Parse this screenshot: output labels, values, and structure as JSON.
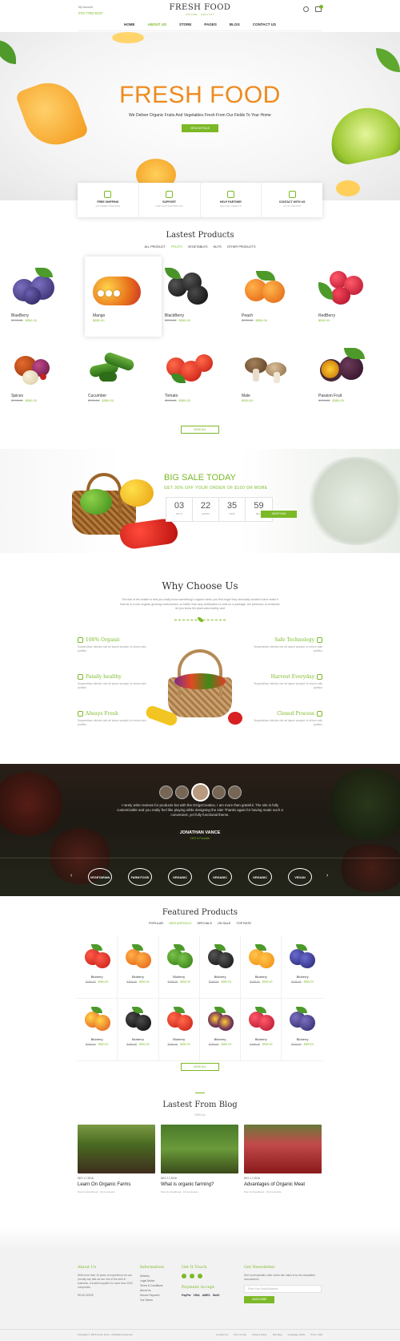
{
  "header": {
    "account": "My Account",
    "phone": "070-7782-9137",
    "logo": "FRESH FOOD",
    "tagline": "NATURE · HEALTHY",
    "nav": [
      "HOME",
      "ABOUT US",
      "STORE",
      "PAGES",
      "BLOG",
      "CONTACT US"
    ],
    "active_nav": "ABOUT US"
  },
  "hero": {
    "title": "FRESH FOOD",
    "subtitle": "We Deliver Organic Fruits And Vegetables Fresh From Our Fields To Your Home",
    "button": "VIEW DETAILS"
  },
  "features": [
    {
      "title": "FREE SHIPPING",
      "sub": "ON ORDER OVER $100",
      "icon": "plane-icon"
    },
    {
      "title": "SUPPORT",
      "sub": "LIVE CHAT SUPPORT 24/7",
      "icon": "support-icon"
    },
    {
      "title": "HELP PARTNER",
      "sub": "HELP ALL ASPECTS",
      "icon": "handshake-icon"
    },
    {
      "title": "CONTACT WITH US",
      "sub": "+07 (0) 7782 9137",
      "icon": "phone-icon"
    }
  ],
  "latest": {
    "title": "Lastest Products",
    "tabs": [
      "ALL PRODUCT",
      "FRUITS",
      "VEGETABLES",
      "NUTS",
      "OTHER PRODUCTS"
    ],
    "active_tab": "FRUITS",
    "products": [
      {
        "name": "BlueBerry",
        "old": "$799.00",
        "price": "$550.00"
      },
      {
        "name": "Mango",
        "old": "",
        "price": "$550.00"
      },
      {
        "name": "BlackBerry",
        "old": "$799.00",
        "price": "$550.00"
      },
      {
        "name": "Peach",
        "old": "$799.00",
        "price": "$550.00"
      },
      {
        "name": "RedBerry",
        "old": "",
        "price": "$550.00"
      },
      {
        "name": "Spices",
        "old": "$799.00",
        "price": "$550.00"
      },
      {
        "name": "Cucumber",
        "old": "$799.00",
        "price": "$550.00"
      },
      {
        "name": "Tomato",
        "old": "$799.00",
        "price": "$550.00"
      },
      {
        "name": "Male",
        "old": "",
        "price": "$550.00"
      },
      {
        "name": "Passion Fruit",
        "old": "$799.00",
        "price": "$550.00"
      }
    ],
    "view_all": "VIEW ALL"
  },
  "sale": {
    "title": "BIG SALE TODAY",
    "sub": "GET 30% OFF YOUR ORDER OF $100 OR MORE",
    "timer": [
      {
        "n": "03",
        "l": "DAYS"
      },
      {
        "n": "22",
        "l": "HOURS"
      },
      {
        "n": "35",
        "l": "MINS"
      },
      {
        "n": "59",
        "l": "SECS"
      }
    ],
    "button": "SHOP NOW"
  },
  "why": {
    "title": "Why Choose Us",
    "para": "The fact of the matter is that you really know something's organic when you find bugs! they obviously wouldn't have made it that far in a non organic growing environment, so better than any certification or seal on a package, the presence of creatures let you know the plant was healthy and",
    "items": [
      {
        "t": "100% Organic",
        "d": "Suspendisse ultricies nisi vel ipsum suscipit, et rutrum odio porttitor"
      },
      {
        "t": "Family healthy",
        "d": "Suspendisse ultricies nisi vel ipsum suscipit, et rutrum odio porttitor"
      },
      {
        "t": "Always Fresh",
        "d": "Suspendisse ultricies nisi vel ipsum suscipit, et rutrum odio porttitor"
      },
      {
        "t": "Safe Technology",
        "d": "Suspendisse ultricies nisi vel ipsum suscipit, et rutrum odio porttitor"
      },
      {
        "t": "Harvest Everyday",
        "d": "Suspendisse ultricies nisi vel ipsum suscipit, et rutrum odio porttitor"
      },
      {
        "t": "Cloned Process",
        "d": "Suspendisse ultricies nisi vel ipsum suscipit, et rutrum odio porttitor"
      }
    ]
  },
  "testimonial": {
    "quote": "I rarely write reviews for products but with the DzigoCreative, I am more than grateful. The site is fully customizable and you really feel like playing while designing the site! Thanks again for having made such a convenient, yet fully functional theme.",
    "name": "JONATHAN VANCE",
    "role": "CEO & Founder",
    "brands": [
      "VEGETARIAN",
      "FARM FOOD",
      "ORGANIC",
      "ORGANIC",
      "ORGANIC",
      "VEGAN"
    ]
  },
  "featured": {
    "title": "Featured Products",
    "tabs": [
      "POPULAR",
      "NEW ARRIVALS",
      "SPECIALS",
      "ON SALE",
      "TOP RATE"
    ],
    "active_tab": "NEW ARRIVALS",
    "products": [
      {
        "name": "Bluberry",
        "old": "$799.00",
        "price": "$550.00"
      },
      {
        "name": "Bluberry",
        "old": "$799.00",
        "price": "$550.00"
      },
      {
        "name": "Bluberry",
        "old": "$799.00",
        "price": "$550.00"
      },
      {
        "name": "Bluberry",
        "old": "$799.00",
        "price": "$550.00"
      },
      {
        "name": "Bluberry",
        "old": "$799.00",
        "price": "$550.00"
      },
      {
        "name": "Bluberry",
        "old": "$799.00",
        "price": "$550.00"
      },
      {
        "name": "Bluberry",
        "old": "$799.00",
        "price": "$550.00"
      },
      {
        "name": "Bluberry",
        "old": "$799.00",
        "price": "$550.00"
      },
      {
        "name": "Bluberry",
        "old": "$799.00",
        "price": "$550.00"
      },
      {
        "name": "Bluberry",
        "old": "$799.00",
        "price": "$550.00"
      },
      {
        "name": "Bluberry",
        "old": "$799.00",
        "price": "$550.00"
      },
      {
        "name": "Bluberry",
        "old": "$799.00",
        "price": "$550.00"
      }
    ],
    "view_all": "VIEW ALL"
  },
  "blog": {
    "title": "Lastest From Blog",
    "sub": "VIEW ALL",
    "posts": [
      {
        "date": "DEC 17,2016",
        "title": "Learn On Organic Farms",
        "meta": "Post by FreshFood · 16 Comments"
      },
      {
        "date": "DEC 17,2016",
        "title": "What is organic farming?",
        "meta": "Post by FreshFood · 16 Comments"
      },
      {
        "date": "DEC 17,2016",
        "title": "Advantages of Organic Meat",
        "meta": "Post by FreshFood · 16 Comments"
      }
    ]
  },
  "footer": {
    "about_h": "About Us",
    "about_t": "With more than 15 years of experience we can proudly say that we are one of the best in business, a trusted supplier for more than 1000 companies.",
    "about_link": "READ MORE",
    "info_h": "Information",
    "info_links": [
      "Delivery",
      "Legal Notice",
      "Terms & Conditions",
      "About Us",
      "Secure Payment",
      "Our Stores"
    ],
    "touch_h": "Get It Touch",
    "payment_h": "Payment Accept",
    "payments": [
      "PayPal",
      "VISA",
      "AMEX",
      "Skrill"
    ],
    "news_h": "Get Newsletter",
    "news_t": "Sed ut perspiciatis unde omnis iste natus error sit voluptatem accusantium",
    "email_placeholder": "Enter Your Email Address",
    "subscribe": "SUBSCRIBE",
    "copyright": "Copyright © 2016 Fresh Food . All Rights Reserved.",
    "bottom_links": [
      "Contact Us",
      "Term of Use",
      "Privacy Policy",
      "Site Map",
      "Language: ENG",
      "Price: USD"
    ]
  }
}
